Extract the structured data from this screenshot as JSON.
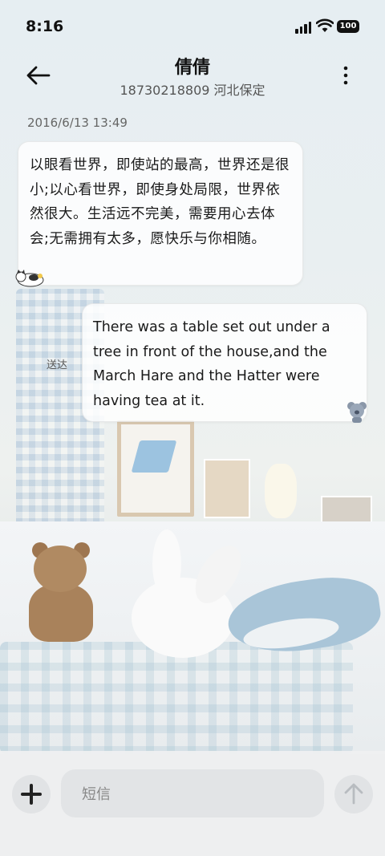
{
  "status_bar": {
    "time": "8:16",
    "battery": "100"
  },
  "header": {
    "contact_name": "倩倩",
    "contact_detail": "18730218809 河北保定"
  },
  "conversation": {
    "timestamp": "2016/6/13 13:49",
    "messages": [
      {
        "direction": "incoming",
        "text": "以眼看世界，即使站的最高，世界还是很小;以心看世界，即使身处局限，世界依然很大。生活远不完美，需要用心去体会;无需拥有太多，愿快乐与你相随。"
      },
      {
        "direction": "outgoing",
        "text": "There was a table set out under a tree in front of the house,and the March Hare and the Hatter were having tea at it.",
        "status": "送达"
      }
    ]
  },
  "composer": {
    "placeholder": "短信"
  },
  "icons": {
    "back": "back-arrow-icon",
    "more": "more-vertical-icon",
    "add": "plus-icon",
    "send": "send-arrow-icon"
  }
}
